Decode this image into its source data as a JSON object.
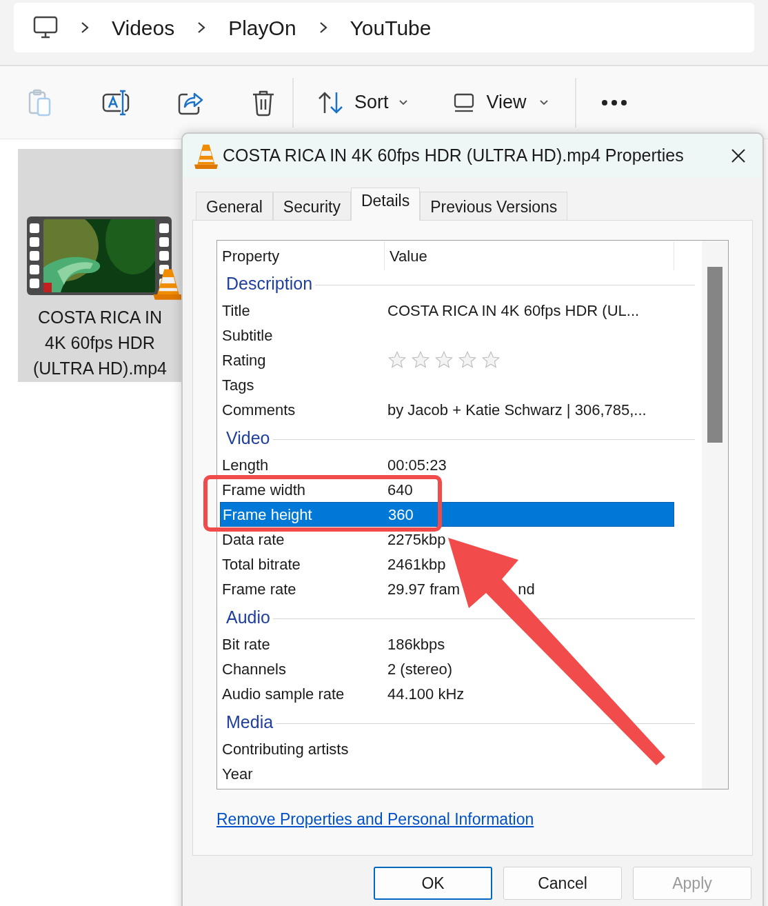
{
  "breadcrumb": [
    {
      "label": "Videos"
    },
    {
      "label": "PlayOn"
    },
    {
      "label": "YouTube"
    }
  ],
  "toolbar": {
    "buttons": [
      {
        "kind": "paste",
        "disabled": true
      },
      {
        "kind": "rename",
        "disabled": false
      },
      {
        "kind": "share",
        "disabled": false
      },
      {
        "kind": "delete",
        "disabled": false
      }
    ],
    "sort": "Sort",
    "view": "View"
  },
  "file": {
    "name_lines": [
      "COSTA RICA IN",
      "4K 60fps HDR",
      "(ULTRA HD).mp4"
    ],
    "selected": true
  },
  "dialog": {
    "title": "COSTA RICA IN 4K 60fps HDR (ULTRA HD).mp4 Properties",
    "tabs": [
      {
        "label": "General",
        "selected": false
      },
      {
        "label": "Security",
        "selected": false
      },
      {
        "label": "Details",
        "selected": true
      },
      {
        "label": "Previous Versions",
        "selected": false
      }
    ],
    "columns": [
      "Property",
      "Value"
    ],
    "sections": [
      {
        "title": "Description",
        "rows": [
          {
            "kind": "text",
            "property": "Title",
            "value": "COSTA RICA IN 4K 60fps HDR (UL...",
            "selected": false
          },
          {
            "kind": "text",
            "property": "Subtitle",
            "selected": false
          },
          {
            "kind": "rating",
            "property": "Rating",
            "stars": 0,
            "selected": false
          },
          {
            "kind": "text",
            "property": "Tags",
            "selected": false
          },
          {
            "kind": "text",
            "property": "Comments",
            "value": "by Jacob + Katie Schwarz | 306,785,...",
            "selected": false
          }
        ]
      },
      {
        "title": "Video",
        "rows": [
          {
            "kind": "text",
            "property": "Length",
            "value": "00:05:23",
            "selected": false
          },
          {
            "kind": "text",
            "property": "Frame width",
            "value": "640",
            "selected": false
          },
          {
            "kind": "text",
            "property": "Frame height",
            "value": "360",
            "selected": true
          },
          {
            "kind": "text",
            "property": "Data rate",
            "value": "2275kbp",
            "selected": false
          },
          {
            "kind": "text",
            "property": "Total bitrate",
            "value": "2461kbp",
            "selected": false
          },
          {
            "kind": "text",
            "property": "Frame rate",
            "value": "29.97 fram",
            "value_after": "nd",
            "selected": false
          }
        ]
      },
      {
        "title": "Audio",
        "rows": [
          {
            "kind": "text",
            "property": "Bit rate",
            "value": "186kbps",
            "selected": false
          },
          {
            "kind": "text",
            "property": "Channels",
            "value": "2 (stereo)",
            "selected": false
          },
          {
            "kind": "text",
            "property": "Audio sample rate",
            "value": "44.100 kHz",
            "selected": false
          }
        ]
      },
      {
        "title": "Media",
        "rows": [
          {
            "kind": "text",
            "property": "Contributing artists",
            "selected": false
          },
          {
            "kind": "text",
            "property": "Year",
            "selected": false
          }
        ]
      }
    ],
    "link": "Remove Properties and Personal Information",
    "buttons": [
      {
        "label": "OK",
        "default": true,
        "disabled": false
      },
      {
        "label": "Cancel",
        "default": false,
        "disabled": false
      },
      {
        "label": "Apply",
        "default": false,
        "disabled": true
      }
    ]
  }
}
